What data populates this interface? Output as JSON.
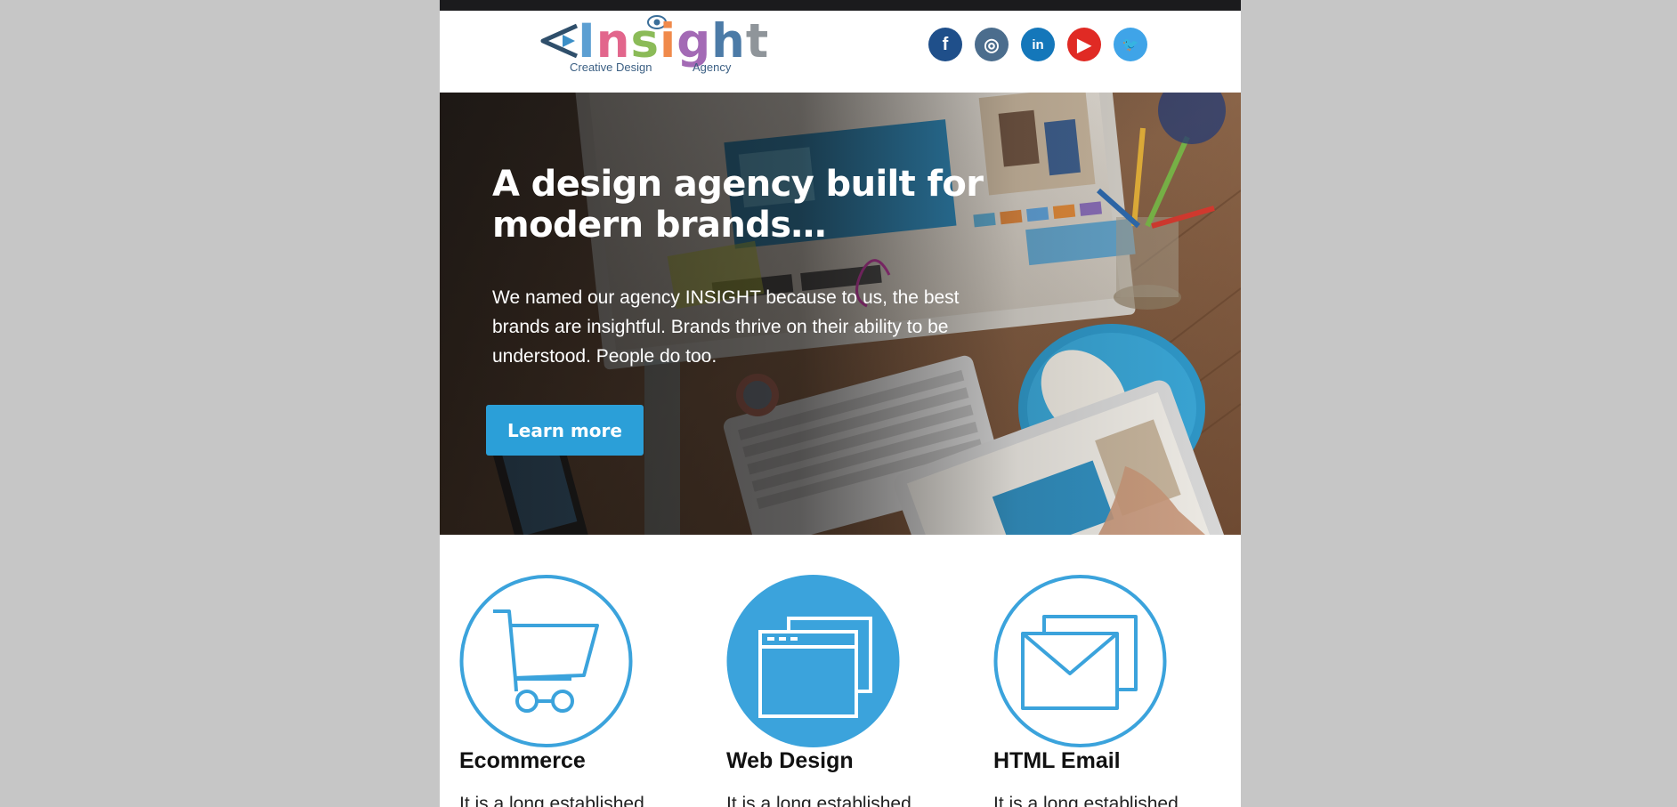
{
  "header": {
    "logo": {
      "word": "Insight",
      "letter_colors": [
        "#5c9fd2",
        "#e2668c",
        "#8bbb58",
        "#f08a4b",
        "#a36ab5",
        "#4c7ba7",
        "#8f959a"
      ],
      "tagline_left": "Creative Design",
      "tagline_right": "Agency"
    },
    "social": [
      {
        "icon": "facebook-icon",
        "glyph": "f",
        "color": "#1f4f8a"
      },
      {
        "icon": "instagram-icon",
        "glyph": "◎",
        "color": "#4b6d8d"
      },
      {
        "icon": "linkedin-icon",
        "glyph": "in",
        "color": "#1477ba"
      },
      {
        "icon": "youtube-icon",
        "glyph": "▶",
        "color": "#e02a24"
      },
      {
        "icon": "twitter-icon",
        "glyph": "🐦",
        "color": "#3fa4e8"
      }
    ]
  },
  "hero": {
    "title": "A design agency built for modern brands…",
    "text": "We named our agency INSIGHT because to us, the best brands are insightful. Brands thrive on their ability to be understood. People do too.",
    "button_label": "Learn more",
    "button_color": "#2b9fd8"
  },
  "services": [
    {
      "icon": "shopping-cart-icon",
      "title": "Ecommerce",
      "text": "It is a long established"
    },
    {
      "icon": "browser-windows-icon",
      "title": "Web Design",
      "text": "It is a long established"
    },
    {
      "icon": "envelope-icon",
      "title": "HTML Email",
      "text": "It is a long established"
    }
  ],
  "colors": {
    "accent": "#3ba3dc",
    "page_background": "#c6c6c6",
    "top_bar": "#1b1b1d"
  }
}
